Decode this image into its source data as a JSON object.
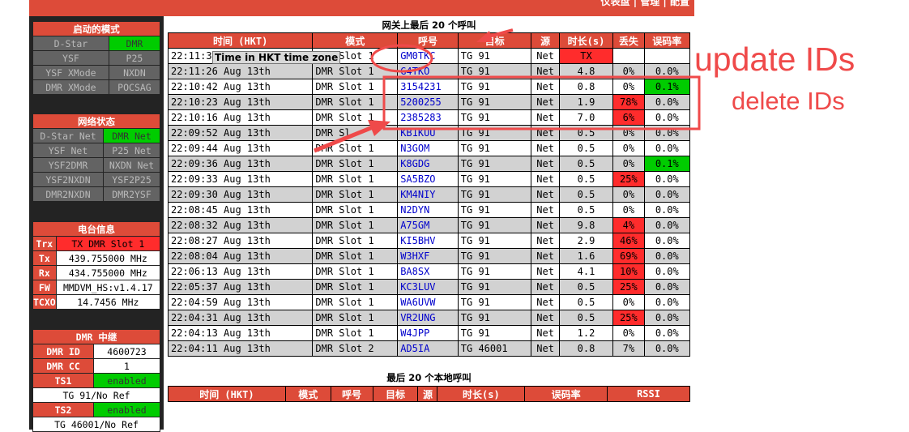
{
  "header": {
    "nav": "仪表盘 | 管理 | 配置"
  },
  "sidebar": {
    "modes": {
      "title": "启动的模式",
      "items": [
        {
          "label": "D-Star",
          "state": "off"
        },
        {
          "label": "DMR",
          "state": "on"
        },
        {
          "label": "YSF",
          "state": "off"
        },
        {
          "label": "P25",
          "state": "off"
        },
        {
          "label": "YSF XMode",
          "state": "off"
        },
        {
          "label": "NXDN",
          "state": "off"
        },
        {
          "label": "DMR XMode",
          "state": "off"
        },
        {
          "label": "POCSAG",
          "state": "off"
        }
      ]
    },
    "network": {
      "title": "网络状态",
      "items": [
        {
          "label": "D-Star Net",
          "state": "off"
        },
        {
          "label": "DMR Net",
          "state": "on"
        },
        {
          "label": "YSF Net",
          "state": "off"
        },
        {
          "label": "P25 Net",
          "state": "off"
        },
        {
          "label": "YSF2DMR",
          "state": "off"
        },
        {
          "label": "NXDN Net",
          "state": "off"
        },
        {
          "label": "YSF2NXDN",
          "state": "off"
        },
        {
          "label": "YSF2P25",
          "state": "off"
        },
        {
          "label": "DMR2NXDN",
          "state": "off"
        },
        {
          "label": "DMR2YSF",
          "state": "off"
        }
      ]
    },
    "radio": {
      "title": "电台信息",
      "rows": [
        {
          "label": "Trx",
          "value": "TX DMR Slot 1",
          "alert": true
        },
        {
          "label": "Tx",
          "value": "439.755000 MHz"
        },
        {
          "label": "Rx",
          "value": "434.755000 MHz"
        },
        {
          "label": "FW",
          "value": "MMDVM_HS:v1.4.17"
        },
        {
          "label": "TCXO",
          "value": "14.7456 MHz"
        }
      ]
    },
    "dmr": {
      "title": "DMR 中继",
      "dmr_id_label": "DMR ID",
      "dmr_id": "4600723",
      "dmr_cc_label": "DMR CC",
      "dmr_cc": "1",
      "ts1_label": "TS1",
      "ts1_state": "enabled",
      "ts1_ref": "TG 91/No Ref",
      "ts2_label": "TS2",
      "ts2_state": "enabled",
      "ts2_ref": "TG 46001/No Ref"
    }
  },
  "gateway": {
    "title_pre": "网关上最后 ",
    "title_count": "20",
    "title_post": " 个呼叫",
    "columns": [
      "时间 (HKT)",
      "模式",
      "呼号",
      "目标",
      "源",
      "时长(s)",
      "丢失",
      "误码率"
    ],
    "rows": [
      [
        "22:11:3",
        "DMR Slot 1",
        "GM0TKC",
        "TG 91",
        "Net",
        "TX",
        "",
        ""
      ],
      [
        "22:11:26 Aug 13th",
        "DMR Slot 1",
        "G4TKO",
        "TG 91",
        "Net",
        "4.8",
        "0%",
        "0.0%"
      ],
      [
        "22:10:42 Aug 13th",
        "DMR Slot 1",
        "3154231",
        "TG 91",
        "Net",
        "0.8",
        "0%",
        "0.1%"
      ],
      [
        "22:10:23 Aug 13th",
        "DMR Slot 1",
        "5200255",
        "TG 91",
        "Net",
        "1.9",
        "78%",
        "0.0%"
      ],
      [
        "22:10:16 Aug 13th",
        "DMR Slot 1",
        "2385283",
        "TG 91",
        "Net",
        "7.0",
        "6%",
        "0.0%"
      ],
      [
        "22:09:52 Aug 13th",
        "DMR Sl",
        "KB1KUU",
        "TG 91",
        "Net",
        "0.5",
        "0%",
        "0.0%"
      ],
      [
        "22:09:44 Aug 13th",
        "DMR Slot 1",
        "N3GOM",
        "TG 91",
        "Net",
        "0.5",
        "0%",
        "0.0%"
      ],
      [
        "22:09:36 Aug 13th",
        "DMR Slot 1",
        "K8GDG",
        "TG 91",
        "Net",
        "0.5",
        "0%",
        "0.1%"
      ],
      [
        "22:09:33 Aug 13th",
        "DMR Slot 1",
        "SA5BZO",
        "TG 91",
        "Net",
        "0.5",
        "25%",
        "0.0%"
      ],
      [
        "22:09:30 Aug 13th",
        "DMR Slot 1",
        "KM4NIY",
        "TG 91",
        "Net",
        "0.5",
        "0%",
        "0.0%"
      ],
      [
        "22:08:45 Aug 13th",
        "DMR Slot 1",
        "N2DYN",
        "TG 91",
        "Net",
        "0.5",
        "0%",
        "0.0%"
      ],
      [
        "22:08:32 Aug 13th",
        "DMR Slot 1",
        "A75GM",
        "TG 91",
        "Net",
        "9.8",
        "4%",
        "0.0%"
      ],
      [
        "22:08:27 Aug 13th",
        "DMR Slot 1",
        "KI5BHV",
        "TG 91",
        "Net",
        "2.9",
        "46%",
        "0.0%"
      ],
      [
        "22:08:04 Aug 13th",
        "DMR Slot 1",
        "W3HXF",
        "TG 91",
        "Net",
        "1.6",
        "69%",
        "0.0%"
      ],
      [
        "22:06:13 Aug 13th",
        "DMR Slot 1",
        "BA8SX",
        "TG 91",
        "Net",
        "4.1",
        "10%",
        "0.0%"
      ],
      [
        "22:05:37 Aug 13th",
        "DMR Slot 1",
        "KC3LUV",
        "TG 91",
        "Net",
        "0.5",
        "25%",
        "0.0%"
      ],
      [
        "22:04:59 Aug 13th",
        "DMR Slot 1",
        "WA6UVW",
        "TG 91",
        "Net",
        "0.5",
        "0%",
        "0.0%"
      ],
      [
        "22:04:31 Aug 13th",
        "DMR Slot 1",
        "VR2UNG",
        "TG 91",
        "Net",
        "0.5",
        "25%",
        "0.0%"
      ],
      [
        "22:04:13 Aug 13th",
        "DMR Slot 1",
        "W4JPP",
        "TG 91",
        "Net",
        "1.2",
        "0%",
        "0.0%"
      ],
      [
        "22:04:11 Aug 13th",
        "DMR Slot 2",
        "AD5IA",
        "TG 46001",
        "Net",
        "0.8",
        "7%",
        "0.0%"
      ]
    ],
    "red_loss": [
      "78%",
      "6%",
      "25%",
      "4%",
      "46%",
      "69%",
      "10%"
    ],
    "green_ber": [
      "0.1%"
    ]
  },
  "local": {
    "title_pre": "最后 ",
    "title_count": "20",
    "title_post": " 个本地呼叫",
    "columns": [
      "时间 (HKT)",
      "模式",
      "呼号",
      "目标",
      "源",
      "时长(s)",
      "误码率",
      "RSSI"
    ]
  },
  "annotations": {
    "tooltip": "Time in HKT time zone",
    "update": "update IDs",
    "delete": "delete IDs",
    "color": "#ef4a4a"
  }
}
